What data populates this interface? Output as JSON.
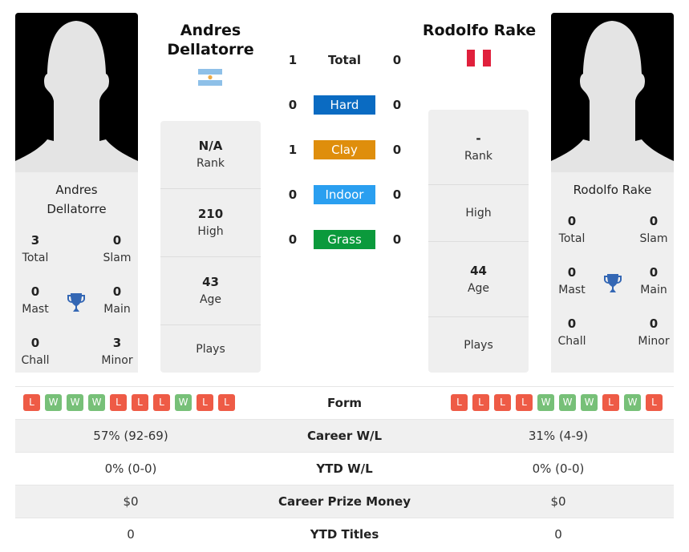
{
  "colors": {
    "hard": "#0a6bc2",
    "clay": "#df8e0c",
    "indoor": "#2a9ff0",
    "grass": "#0b9a3c",
    "win": "#77c078",
    "loss": "#ee5b46",
    "trophy": "#3467b4"
  },
  "player1": {
    "name": "Andres Dellatorre",
    "name_line1": "Andres",
    "name_line2": "Dellatorre",
    "flag": "argentina-flag",
    "titles": {
      "total": {
        "value": "3",
        "label": "Total"
      },
      "slam": {
        "value": "0",
        "label": "Slam"
      },
      "mast": {
        "value": "0",
        "label": "Mast"
      },
      "main": {
        "value": "0",
        "label": "Main"
      },
      "chall": {
        "value": "0",
        "label": "Chall"
      },
      "minor": {
        "value": "3",
        "label": "Minor"
      }
    },
    "stats": [
      {
        "value": "N/A",
        "label": "Rank"
      },
      {
        "value": "210",
        "label": "High"
      },
      {
        "value": "43",
        "label": "Age"
      },
      {
        "value": "",
        "label": "Plays"
      }
    ],
    "form": [
      "L",
      "W",
      "W",
      "W",
      "L",
      "L",
      "L",
      "W",
      "L",
      "L"
    ],
    "career_wl": "57% (92-69)",
    "ytd_wl": "0% (0-0)",
    "prize_money": "$0",
    "ytd_titles": "0"
  },
  "player2": {
    "name": "Rodolfo Rake",
    "flag": "peru-flag",
    "titles": {
      "total": {
        "value": "0",
        "label": "Total"
      },
      "slam": {
        "value": "0",
        "label": "Slam"
      },
      "mast": {
        "value": "0",
        "label": "Mast"
      },
      "main": {
        "value": "0",
        "label": "Main"
      },
      "chall": {
        "value": "0",
        "label": "Chall"
      },
      "minor": {
        "value": "0",
        "label": "Minor"
      }
    },
    "stats": [
      {
        "value": "-",
        "label": "Rank"
      },
      {
        "value": "",
        "label": "High"
      },
      {
        "value": "44",
        "label": "Age"
      },
      {
        "value": "",
        "label": "Plays"
      }
    ],
    "form": [
      "L",
      "L",
      "L",
      "L",
      "W",
      "W",
      "W",
      "L",
      "W",
      "L"
    ],
    "career_wl": "31% (4-9)",
    "ytd_wl": "0% (0-0)",
    "prize_money": "$0",
    "ytd_titles": "0"
  },
  "h2h": {
    "total": {
      "label": "Total",
      "p1": "1",
      "p2": "0"
    },
    "surfaces": [
      {
        "label": "Hard",
        "p1": "0",
        "p2": "0"
      },
      {
        "label": "Clay",
        "p1": "1",
        "p2": "0"
      },
      {
        "label": "Indoor",
        "p1": "0",
        "p2": "0"
      },
      {
        "label": "Grass",
        "p1": "0",
        "p2": "0"
      }
    ]
  },
  "table": {
    "form_label": "Form",
    "career_wl_label": "Career W/L",
    "ytd_wl_label": "YTD W/L",
    "prize_label": "Career Prize Money",
    "ytd_titles_label": "YTD Titles"
  }
}
